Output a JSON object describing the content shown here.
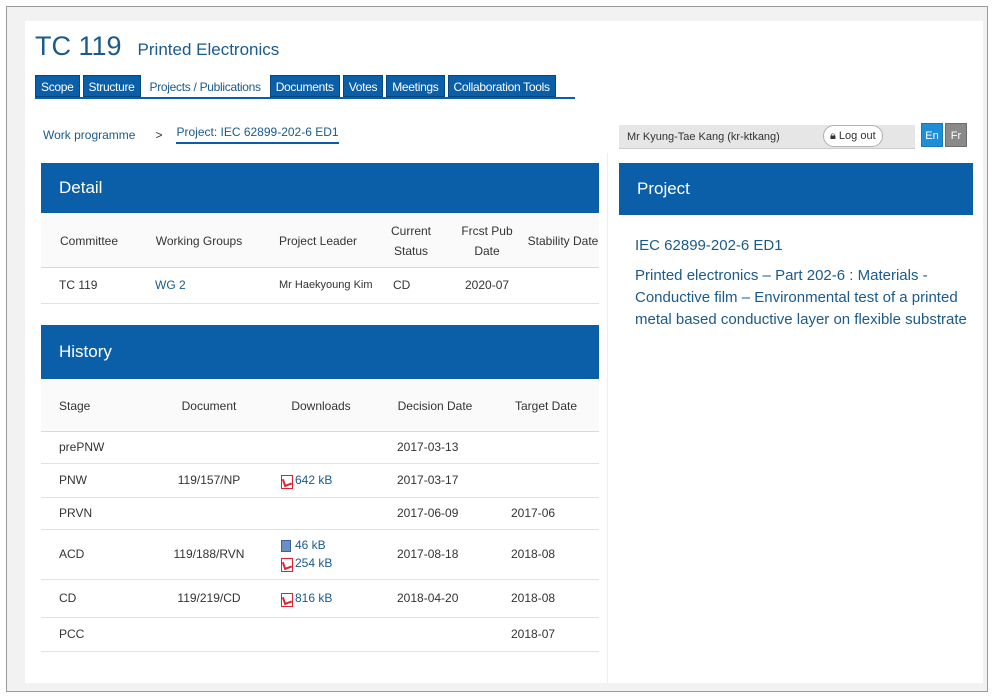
{
  "header": {
    "code": "TC 119",
    "name": "Printed Electronics"
  },
  "tabs": [
    "Scope",
    "Structure",
    "Projects / Publications",
    "Documents",
    "Votes",
    "Meetings",
    "Collaboration Tools"
  ],
  "breadcrumb": {
    "parent": "Work programme",
    "separator": ">",
    "current": "Project: IEC 62899-202-6 ED1"
  },
  "user": {
    "name": "Mr Kyung-Tae Kang (kr-ktkang)",
    "logout": "Log out",
    "lang_en": "En",
    "lang_fr": "Fr"
  },
  "detail": {
    "title": "Detail",
    "headers": [
      "Committee",
      "Working Groups",
      "Project Leader",
      "Current Status",
      "Frcst Pub Date",
      "Stability Date"
    ],
    "row": [
      "TC 119",
      "WG 2",
      "Mr Haekyoung Kim",
      "CD",
      "2020-07",
      ""
    ]
  },
  "history": {
    "title": "History",
    "headers": [
      "Stage",
      "Document",
      "Downloads",
      "Decision Date",
      "Target Date"
    ],
    "rows": [
      {
        "stage": "prePNW",
        "document": "",
        "downloads": [],
        "decision": "2017-03-13",
        "target": ""
      },
      {
        "stage": "PNW",
        "document": "119/157/NP",
        "downloads": [
          {
            "type": "pdf",
            "size": "642 kB"
          }
        ],
        "decision": "2017-03-17",
        "target": ""
      },
      {
        "stage": "PRVN",
        "document": "",
        "downloads": [],
        "decision": "2017-06-09",
        "target": "2017-06"
      },
      {
        "stage": "ACD",
        "document": "119/188/RVN",
        "downloads": [
          {
            "type": "doc",
            "size": "46 kB"
          },
          {
            "type": "pdf",
            "size": "254 kB"
          }
        ],
        "decision": "2017-08-18",
        "target": "2018-08"
      },
      {
        "stage": "CD",
        "document": "119/219/CD",
        "downloads": [
          {
            "type": "pdf",
            "size": "816 kB"
          }
        ],
        "decision": "2018-04-20",
        "target": "2018-08"
      },
      {
        "stage": "PCC",
        "document": "",
        "downloads": [],
        "decision": "",
        "target": "2018-07"
      }
    ]
  },
  "project": {
    "heading": "Project",
    "id": "IEC 62899-202-6 ED1",
    "description": "Printed electronics – Part 202-6 : Materials - Conductive film – Environmental test of a printed metal based conductive layer on flexible substrate"
  },
  "colors": {
    "accent": "#0b5fa8",
    "link": "#1a5a8c"
  }
}
